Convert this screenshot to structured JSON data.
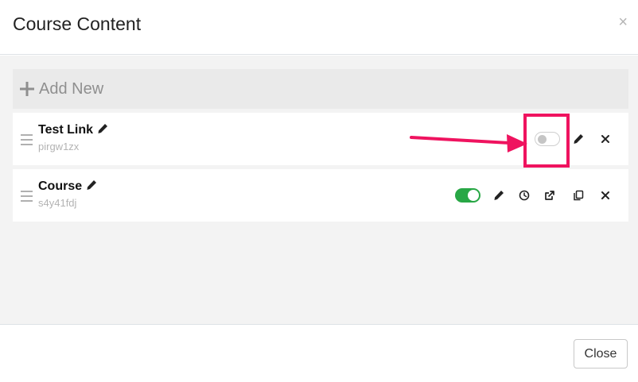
{
  "modal": {
    "title": "Course Content",
    "close_icon": "×",
    "add_new_label": "Add New",
    "items": [
      {
        "name": "Test Link",
        "code": "pirgw1zx",
        "enabled": false
      },
      {
        "name": "Course",
        "code": "s4y41fdj",
        "enabled": true
      }
    ],
    "close_button_label": "Close"
  },
  "colors": {
    "toggle_on": "#28a745",
    "highlight": "#ef135f"
  }
}
